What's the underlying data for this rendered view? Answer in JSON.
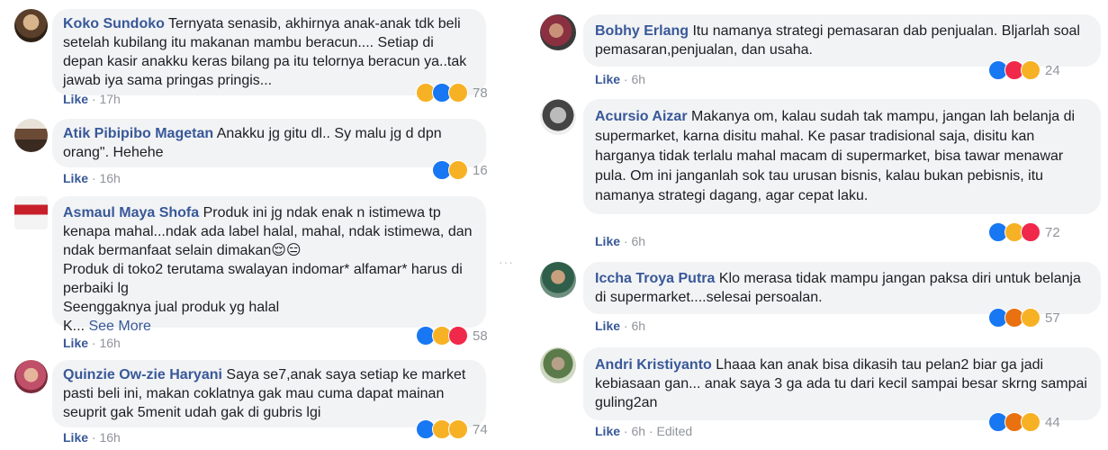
{
  "comments_left": [
    {
      "author": "Koko Sundoko",
      "text": "Ternyata senasib, akhirnya anak-anak tdk beli setelah kubilang itu makanan mambu beracun.... Setiap di depan kasir anakku keras bilang pa itu telornya beracun ya..tak jawab iya sama pringas pringis...",
      "like": "Like",
      "time": "17h",
      "reactions": [
        "haha",
        "like",
        "wow"
      ],
      "count": "78"
    },
    {
      "author": "Atik Pibipibo Magetan",
      "text": "Anakku jg gitu dl.. Sy malu jg d dpn orang\". Hehehe",
      "like": "Like",
      "time": "16h",
      "reactions": [
        "like",
        "haha"
      ],
      "count": "16"
    },
    {
      "author": "Asmaul Maya Shofa",
      "text": "Produk ini jg ndak enak n istimewa tp kenapa mahal...ndak ada label halal, mahal, ndak istimewa, dan ndak bermanfaat selain dimakan😌😑\nProduk di toko2 terutama swalayan indomar* alfamar* harus di perbaiki lg\nSeenggaknya jual produk yg halal\nK...",
      "see_more": "See More",
      "like": "Like",
      "time": "16h",
      "reactions": [
        "like",
        "haha",
        "love"
      ],
      "count": "58"
    },
    {
      "author": "Quinzie Ow-zie Haryani",
      "text": "Saya se7,anak saya setiap ke market pasti beli ini, makan coklatnya gak mau cuma dapat mainan seuprit gak 5menit udah gak di gubris lgi",
      "like": "Like",
      "time": "16h",
      "reactions": [
        "like",
        "haha",
        "wow"
      ],
      "count": "74"
    }
  ],
  "comments_right": [
    {
      "author": "Bobhy Erlang",
      "text": "Itu namanya strategi pemasaran dab penjualan. Bljarlah soal pemasaran,penjualan, dan usaha.",
      "like": "Like",
      "time": "6h",
      "reactions": [
        "like",
        "love",
        "haha"
      ],
      "count": "24"
    },
    {
      "author": "Acursio Aizar",
      "text": "Makanya om, kalau sudah tak mampu, jangan lah belanja di supermarket, karna disitu mahal. Ke pasar tradisional saja, disitu kan harganya tidak terlalu mahal macam di supermarket, bisa tawar menawar pula. Om ini janganlah sok tau urusan bisnis, kalau bukan pebisnis, itu namanya strategi dagang, agar cepat laku.",
      "like": "Like",
      "time": "6h",
      "reactions": [
        "like",
        "haha",
        "love"
      ],
      "count": "72"
    },
    {
      "author": "Iccha Troya Putra",
      "text": "Klo merasa tidak mampu jangan paksa diri untuk belanja di supermarket....selesai persoalan.",
      "like": "Like",
      "time": "6h",
      "reactions": [
        "like",
        "angry",
        "haha"
      ],
      "count": "57"
    },
    {
      "author": "Andri Kristiyanto",
      "text": "Lhaaa kan anak bisa dikasih tau pelan2 biar ga jadi kebiasaan gan... anak saya 3 ga ada tu dari kecil sampai besar skrng sampai guling2an",
      "like": "Like",
      "time": "6h",
      "edited": "Edited",
      "reactions": [
        "like",
        "angry",
        "sad"
      ],
      "count": "44"
    }
  ],
  "divider_glyph": "···",
  "reaction_colors": {
    "like": "#1877f2",
    "love": "#f0284a",
    "haha": "#f7b125",
    "wow": "#f7b125",
    "angry": "#e9710f",
    "sad": "#f7b125"
  }
}
